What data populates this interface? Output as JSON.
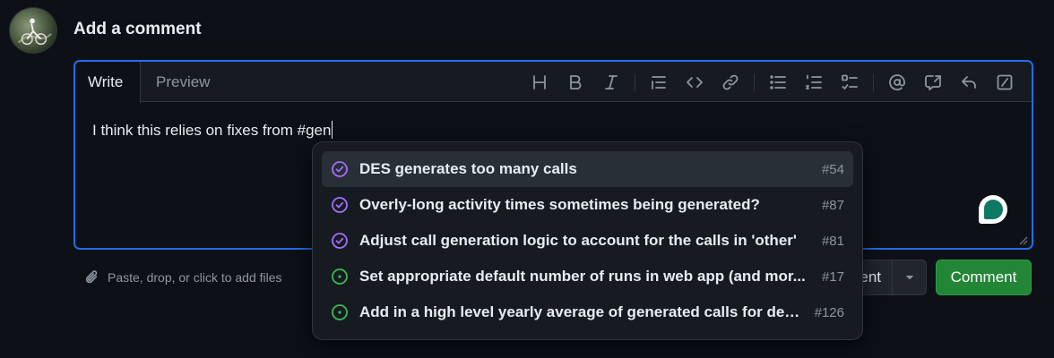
{
  "heading": "Add a comment",
  "tabs": {
    "write": "Write",
    "preview": "Preview"
  },
  "toolbar": [
    "heading-icon",
    "bold-icon",
    "italic-icon",
    "quote-icon",
    "code-icon",
    "link-icon",
    "unordered-list-icon",
    "ordered-list-icon",
    "task-list-icon",
    "mention-icon",
    "cross-reference-icon",
    "reply-icon",
    "slash-commands-icon"
  ],
  "editor": {
    "text": "I think this relies on fixes from #gen"
  },
  "suggestions": [
    {
      "title": "DES generates too many calls",
      "number": "#54",
      "state": "closed"
    },
    {
      "title": "Overly-long activity times sometimes being generated?",
      "number": "#87",
      "state": "closed"
    },
    {
      "title": "Adjust call generation logic to account for the calls in 'other'",
      "number": "#81",
      "state": "closed"
    },
    {
      "title": "Set appropriate default number of runs in web app (and mor...",
      "number": "#17",
      "state": "open"
    },
    {
      "title": "Add in a high level yearly average of generated calls for deb...",
      "number": "#126",
      "state": "open"
    }
  ],
  "footer": {
    "attach_hint": "Paste, drop, or click to add files",
    "close_label": "ent",
    "comment_label": "Comment"
  },
  "colors": {
    "accent": "#1f6feb",
    "closed": "#a371f7",
    "open": "#3fb950",
    "primary_button": "#238636"
  }
}
